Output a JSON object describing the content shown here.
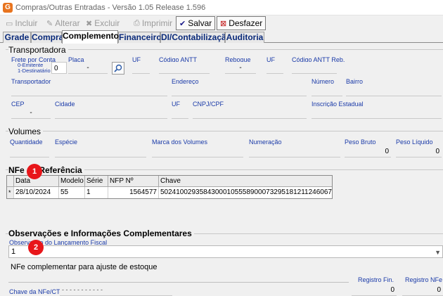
{
  "window": {
    "title": "Compras/Outras Entradas - Versão 1.05 Release 1.596",
    "icon_letter": "G"
  },
  "toolbar": {
    "incluir": "Incluir",
    "alterar": "Alterar",
    "excluir": "Excluir",
    "imprimir": "Imprimir",
    "salvar": "Salvar",
    "desfazer": "Desfazer"
  },
  "tabs": [
    "Grade",
    "Compra",
    "Complemento",
    "Financeiro",
    "DI/Contabilização",
    "Auditoria"
  ],
  "transportadora": {
    "title": "Transportadora",
    "frete_label": "Frete por Conta",
    "frete_opt1": "0-Emitente",
    "frete_opt2": "1-Destinatário",
    "frete_value": "0",
    "placa_label": "Placa",
    "placa_value": "-",
    "uf_label": "UF",
    "antt_label": "Código ANTT",
    "reboque_label": "Reboque",
    "reboque_value": "-",
    "uf2_label": "UF",
    "antt_reb_label": "Código ANTT Reb.",
    "transportador_label": "Transportador",
    "endereco_label": "Endereço",
    "numero_label": "Número",
    "bairro_label": "Bairro",
    "cep_label": "CEP",
    "cep_value": "-",
    "cidade_label": "Cidade",
    "uf3_label": "UF",
    "cnpj_label": "CNPJ/CPF",
    "ie_label": "Inscrição Estadual"
  },
  "volumes": {
    "title": "Volumes",
    "quantidade_label": "Quantidade",
    "especie_label": "Espécie",
    "marca_label": "Marca dos Volumes",
    "numeracao_label": "Numeração",
    "peso_bruto_label": "Peso Bruto",
    "peso_bruto_value": "0",
    "peso_liquido_label": "Peso Líquido",
    "peso_liquido_value": "0"
  },
  "nfe_ref": {
    "title": "NFe de Referência",
    "columns": [
      "Data",
      "Modelo",
      "Série",
      "NFP Nº",
      "Chave"
    ],
    "rows": [
      {
        "marker": "*",
        "data": "28/10/2024",
        "modelo": "55",
        "serie": "1",
        "nfp": "1564577",
        "chave": "50241002935843000105558900073295181211246067"
      }
    ]
  },
  "obs": {
    "title": "Observações e Informações Complementares",
    "obs_label": "Observação do Lançamento Fiscal",
    "obs_value": "1",
    "memo_text": "NFe complementar para ajuste de estoque",
    "chave_label": "Chave da NFe/CTe",
    "chave_value": "-   -   -   -   -   -   -   -   -   -   -",
    "registro_fin_label": "Registro Fin.",
    "registro_fin_value": "0",
    "registro_nfe_label": "Registro NFe",
    "registro_nfe_value": "0"
  },
  "annotations": {
    "badge1": "1",
    "badge2": "2"
  }
}
